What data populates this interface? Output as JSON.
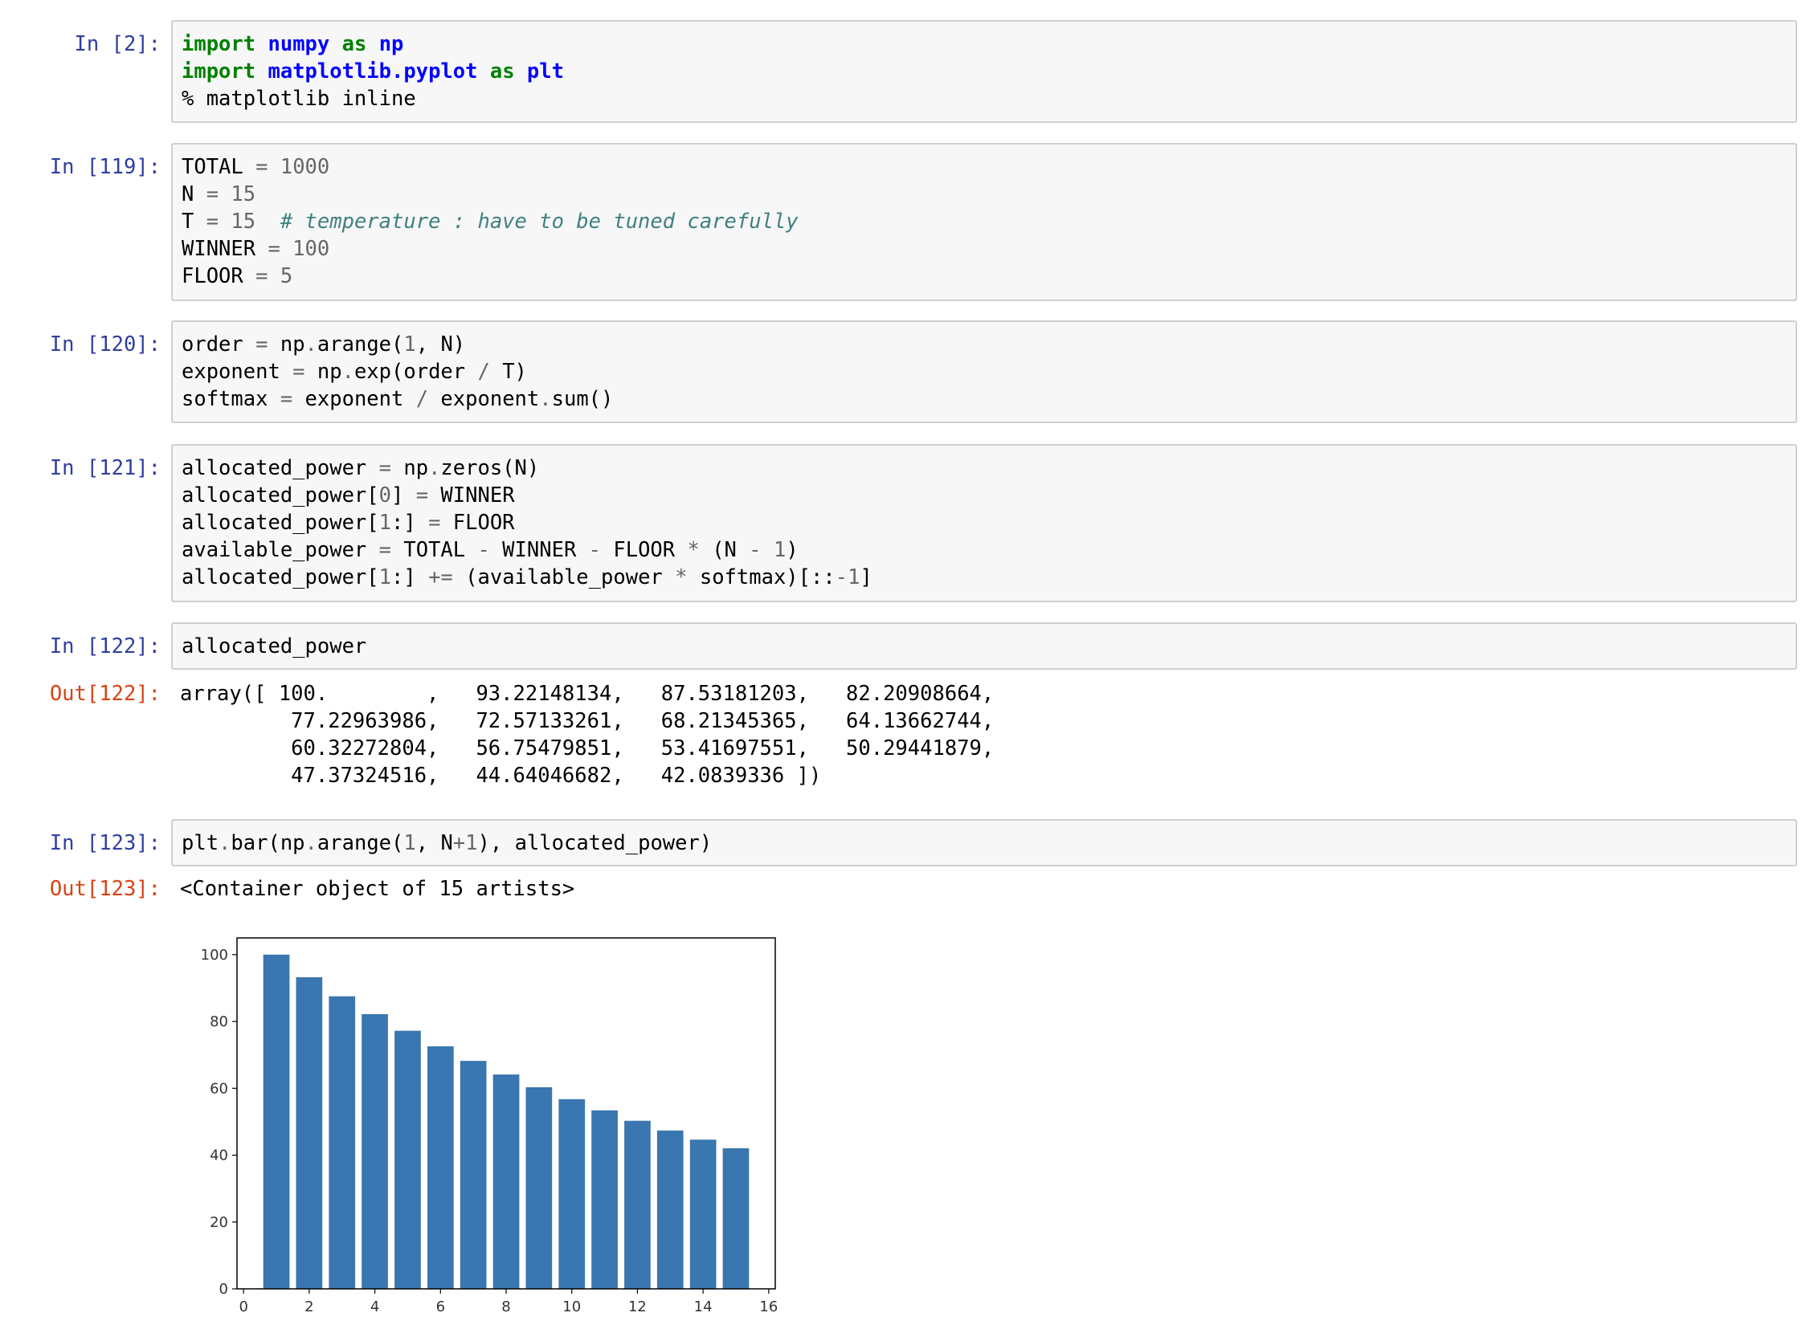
{
  "cells": [
    {
      "prompt": "In [2]:"
    },
    {
      "prompt": "In [119]:"
    },
    {
      "prompt": "In [120]:"
    },
    {
      "prompt": "In [121]:"
    },
    {
      "prompt": "In [122]:",
      "out_prompt": "Out[122]:",
      "output_lines": [
        "array([ 100.        ,   93.22148134,   87.53181203,   82.20908664,",
        "         77.22963986,   72.57133261,   68.21345365,   64.13662744,",
        "         60.32272804,   56.75479851,   53.41697551,   50.29441879,",
        "         47.37324516,   44.64046682,   42.0839336 ])"
      ]
    },
    {
      "prompt": "In [123]:",
      "out_prompt": "Out[123]:",
      "output_text": "<Container object of 15 artists>"
    }
  ],
  "code": {
    "c2_l1_a": "import",
    "c2_l1_b": "numpy",
    "c2_l1_c": "as",
    "c2_l1_d": "np",
    "c2_l2_a": "import",
    "c2_l2_b": "matplotlib.pyplot",
    "c2_l2_c": "as",
    "c2_l2_d": "plt",
    "c2_l3": "% matplotlib inline",
    "c119_l1_a": "TOTAL ",
    "c119_l1_b": "=",
    "c119_l1_c": " 1000",
    "c119_l2_a": "N ",
    "c119_l2_b": "=",
    "c119_l2_c": " 15",
    "c119_l3_a": "T ",
    "c119_l3_b": "=",
    "c119_l3_c": " 15",
    "c119_l3_d": "  # temperature : have to be tuned carefully",
    "c119_l4_a": "WINNER ",
    "c119_l4_b": "=",
    "c119_l4_c": " 100",
    "c119_l5_a": "FLOOR ",
    "c119_l5_b": "=",
    "c119_l5_c": " 5",
    "c120_l1_a": "order ",
    "c120_l1_b": "=",
    "c120_l1_c": " np",
    "c120_l1_d": ".",
    "c120_l1_e": "arange(",
    "c120_l1_f": "1",
    "c120_l1_g": ", N)",
    "c120_l2_a": "exponent ",
    "c120_l2_b": "=",
    "c120_l2_c": " np",
    "c120_l2_d": ".",
    "c120_l2_e": "exp(order ",
    "c120_l2_f": "/",
    "c120_l2_g": " T)",
    "c120_l3_a": "softmax ",
    "c120_l3_b": "=",
    "c120_l3_c": " exponent ",
    "c120_l3_d": "/",
    "c120_l3_e": " exponent",
    "c120_l3_f": ".",
    "c120_l3_g": "sum()",
    "c121_l1_a": "allocated_power ",
    "c121_l1_b": "=",
    "c121_l1_c": " np",
    "c121_l1_d": ".",
    "c121_l1_e": "zeros(N)",
    "c121_l2_a": "allocated_power[",
    "c121_l2_b": "0",
    "c121_l2_c": "] ",
    "c121_l2_d": "=",
    "c121_l2_e": " WINNER",
    "c121_l3_a": "allocated_power[",
    "c121_l3_b": "1",
    "c121_l3_c": ":] ",
    "c121_l3_d": "=",
    "c121_l3_e": " FLOOR",
    "c121_l4_a": "available_power ",
    "c121_l4_b": "=",
    "c121_l4_c": " TOTAL ",
    "c121_l4_d": "-",
    "c121_l4_e": " WINNER ",
    "c121_l4_f": "-",
    "c121_l4_g": " FLOOR ",
    "c121_l4_h": "*",
    "c121_l4_i": " (N ",
    "c121_l4_j": "-",
    "c121_l4_k": " ",
    "c121_l4_l": "1",
    "c121_l4_m": ")",
    "c121_l5_a": "allocated_power[",
    "c121_l5_b": "1",
    "c121_l5_c": ":] ",
    "c121_l5_d": "+=",
    "c121_l5_e": " (available_power ",
    "c121_l5_f": "*",
    "c121_l5_g": " softmax)[::",
    "c121_l5_h": "-1",
    "c121_l5_i": "]",
    "c122_l1": "allocated_power",
    "c123_l1_a": "plt",
    "c123_l1_b": ".",
    "c123_l1_c": "bar(np",
    "c123_l1_d": ".",
    "c123_l1_e": "arange(",
    "c123_l1_f": "1",
    "c123_l1_g": ", N",
    "c123_l1_h": "+",
    "c123_l1_i": "1",
    "c123_l1_j": "), allocated_power)"
  },
  "chart_data": {
    "type": "bar",
    "x": [
      1,
      2,
      3,
      4,
      5,
      6,
      7,
      8,
      9,
      10,
      11,
      12,
      13,
      14,
      15
    ],
    "values": [
      100.0,
      93.22148134,
      87.53181203,
      82.20908664,
      77.22963986,
      72.57133261,
      68.21345365,
      64.13662744,
      60.32272804,
      56.75479851,
      53.41697551,
      50.29441879,
      47.37324516,
      44.64046682,
      42.0839336
    ],
    "xlim": [
      -0.2,
      16.2
    ],
    "ylim": [
      0,
      105
    ],
    "xticks": [
      "0",
      "2",
      "4",
      "6",
      "8",
      "10",
      "12",
      "14",
      "16"
    ],
    "yticks": [
      "0",
      "20",
      "40",
      "60",
      "80",
      "100"
    ],
    "bar_color": "#3a76af",
    "grid": false
  }
}
